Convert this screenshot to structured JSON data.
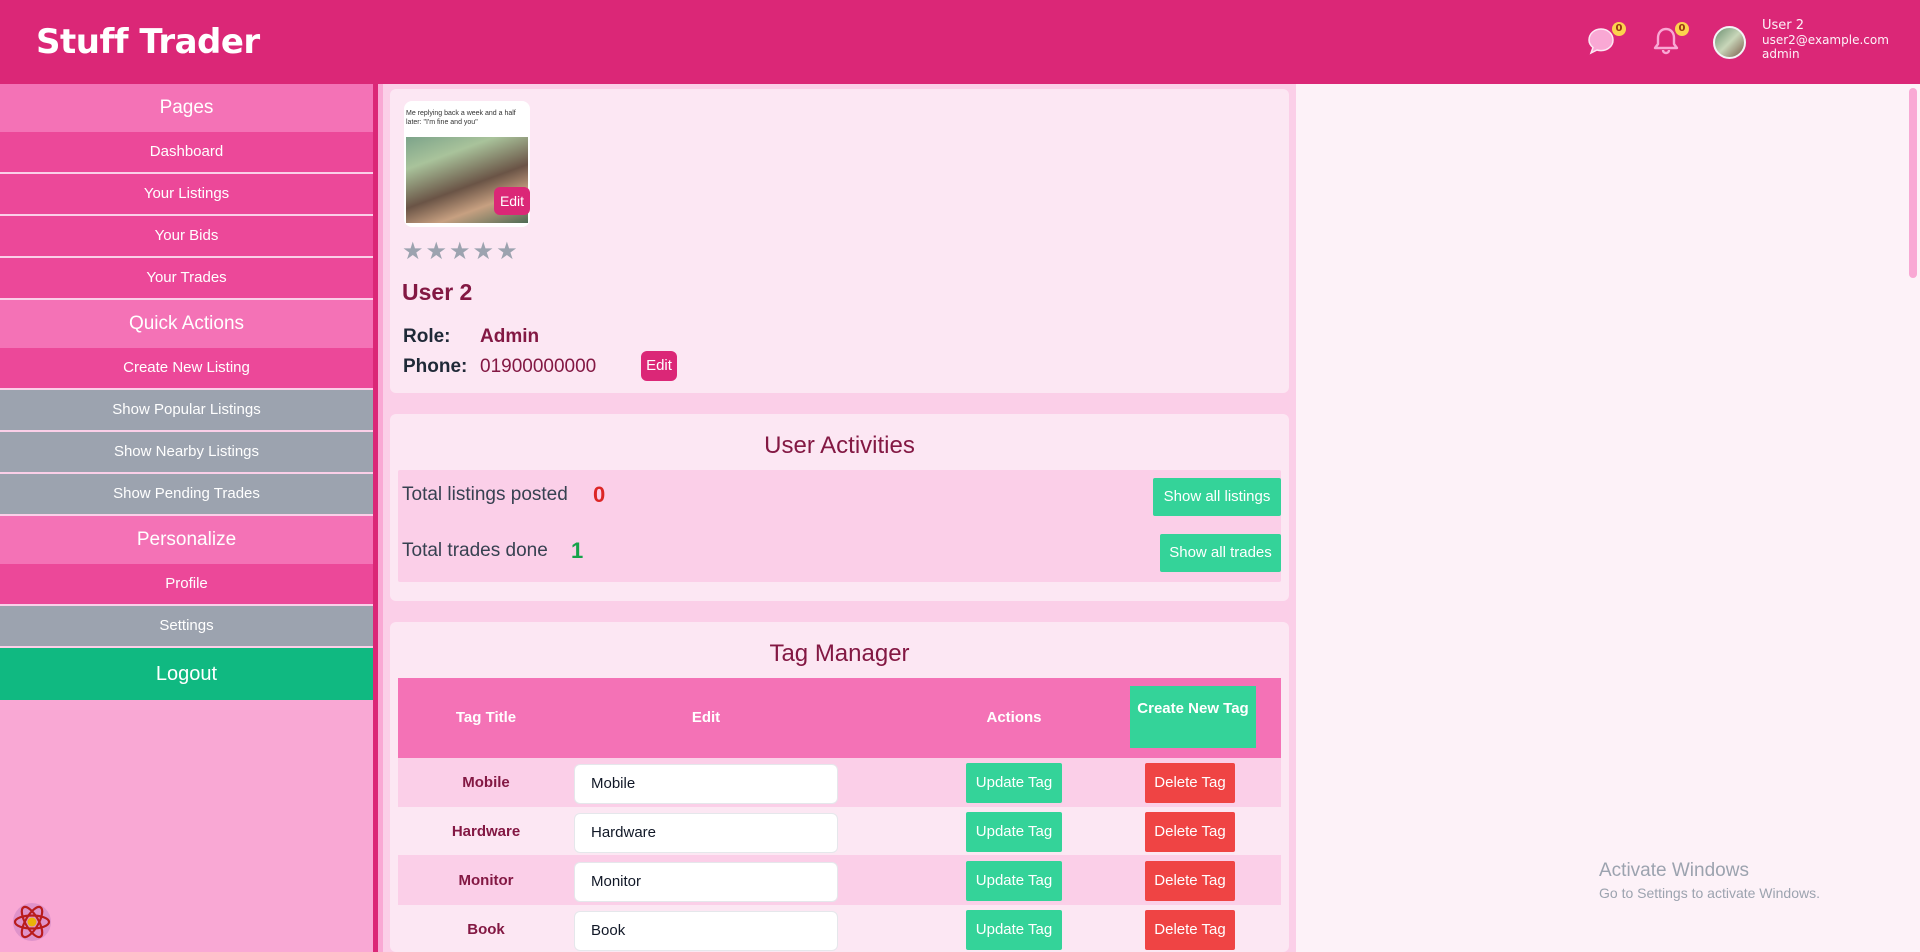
{
  "header": {
    "brand": "Stuff Trader",
    "messages_count": "0",
    "notifications_count": "0",
    "user_name": "User 2",
    "user_email": "user2@example.com",
    "user_role": "admin"
  },
  "sidebar": {
    "sections": [
      {
        "title": "Pages",
        "items": [
          {
            "label": "Dashboard",
            "style": "pink"
          },
          {
            "label": "Your Listings",
            "style": "pink"
          },
          {
            "label": "Your Bids",
            "style": "pink"
          },
          {
            "label": "Your Trades",
            "style": "pink"
          }
        ]
      },
      {
        "title": "Quick Actions",
        "items": [
          {
            "label": "Create New Listing",
            "style": "pink"
          },
          {
            "label": "Show Popular Listings",
            "style": "gray"
          },
          {
            "label": "Show Nearby Listings",
            "style": "gray"
          },
          {
            "label": "Show Pending Trades",
            "style": "gray"
          }
        ]
      },
      {
        "title": "Personalize",
        "items": [
          {
            "label": "Profile",
            "style": "pink"
          },
          {
            "label": "Settings",
            "style": "gray"
          }
        ]
      }
    ],
    "logout": "Logout"
  },
  "profile": {
    "photo_caption": "Me replying back a week and a half later: \"I'm fine and you\"",
    "photo_edit": "Edit",
    "rating": 0,
    "name": "User 2",
    "role_label": "Role:",
    "role_value": "Admin",
    "phone_label": "Phone:",
    "phone_value": "01900000000",
    "phone_edit": "Edit"
  },
  "activities": {
    "title": "User Activities",
    "listings_label": "Total listings posted",
    "listings_count": "0",
    "listings_button": "Show all listings",
    "trades_label": "Total trades done",
    "trades_count": "1",
    "trades_button": "Show all trades"
  },
  "tags": {
    "title": "Tag Manager",
    "headers": [
      "Tag Title",
      "Edit",
      "Actions"
    ],
    "create_button": "Create New Tag",
    "update_label": "Update Tag",
    "delete_label": "Delete Tag",
    "rows": [
      {
        "title": "Mobile",
        "value": "Mobile"
      },
      {
        "title": "Hardware",
        "value": "Hardware"
      },
      {
        "title": "Monitor",
        "value": "Monitor"
      },
      {
        "title": "Book",
        "value": "Book"
      }
    ]
  },
  "watermark": {
    "line1": "Activate Windows",
    "line2": "Go to Settings to activate Windows."
  },
  "colors": {
    "header": "#db2777",
    "sidebar_section": "#f472b6",
    "sidebar_item": "#ec4899",
    "sidebar_disabled": "#9ca3af",
    "logout": "#10b981",
    "accent_green": "#34d399",
    "danger": "#ef4444"
  }
}
